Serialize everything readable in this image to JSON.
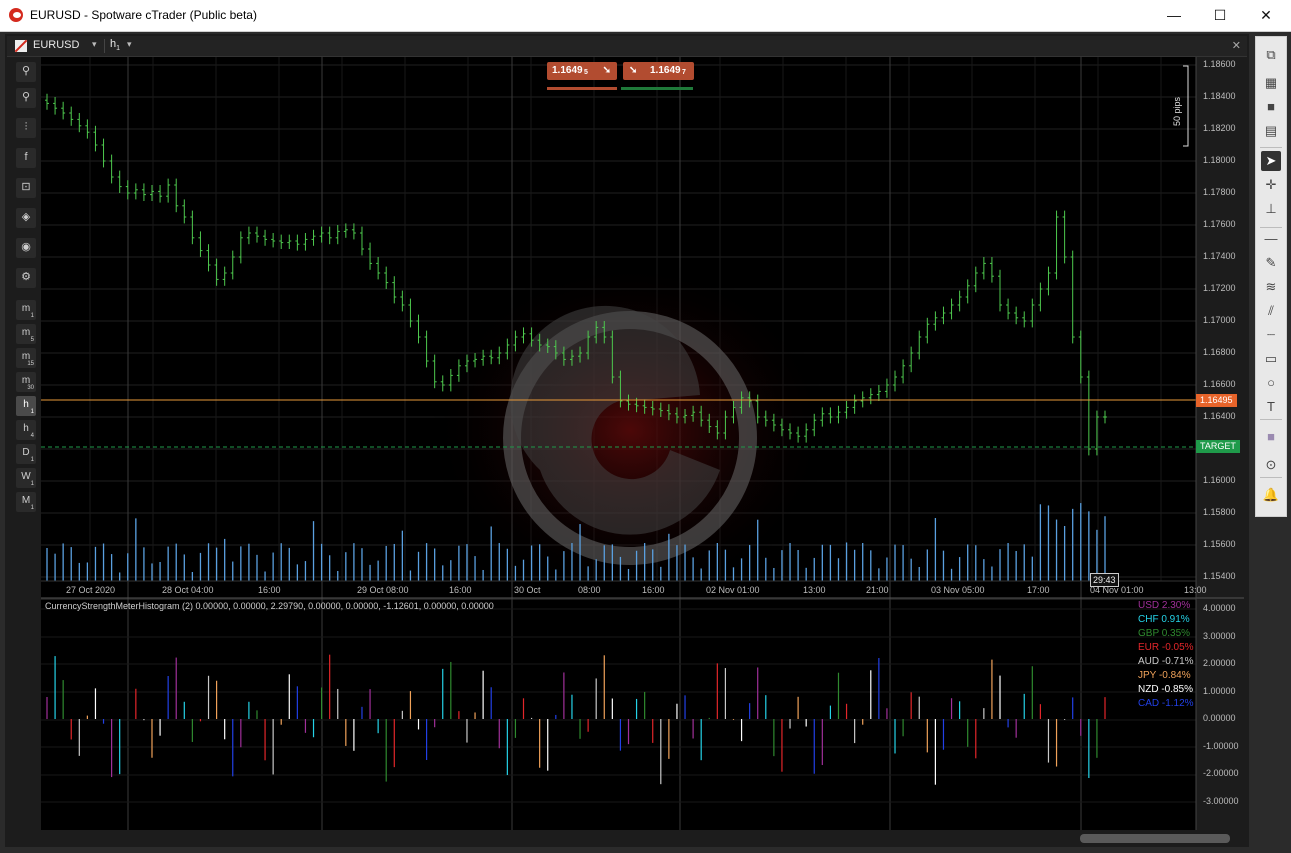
{
  "window": {
    "title": "EURUSD - Spotware cTrader (Public beta)",
    "minimize": "—",
    "maximize": "☐",
    "close": "✕"
  },
  "symbol_bar": {
    "symbol": "EURUSD",
    "timeframe": "h",
    "timeframe_sub": "1",
    "dropdown": "▾"
  },
  "left_toolbar": {
    "tools": [
      {
        "name": "zoom-in-icon",
        "glyph": "⚲"
      },
      {
        "name": "zoom-out-icon",
        "glyph": "⚲"
      },
      {
        "name": "indicators-icon",
        "glyph": "⫶"
      },
      {
        "name": "facebook-icon",
        "glyph": "f"
      },
      {
        "name": "robot-icon",
        "glyph": "⊡"
      },
      {
        "name": "layers-icon",
        "glyph": "◈"
      },
      {
        "name": "eye-icon",
        "glyph": "◉"
      },
      {
        "name": "settings-icon",
        "glyph": "⚙"
      }
    ],
    "timeframes": [
      {
        "label": "m",
        "sub": "1"
      },
      {
        "label": "m",
        "sub": "5"
      },
      {
        "label": "m",
        "sub": "15"
      },
      {
        "label": "m",
        "sub": "30"
      },
      {
        "label": "h",
        "sub": "1"
      },
      {
        "label": "h",
        "sub": "4"
      },
      {
        "label": "D",
        "sub": "1"
      },
      {
        "label": "W",
        "sub": "1"
      },
      {
        "label": "M",
        "sub": "1"
      }
    ],
    "active_timeframe": 4
  },
  "right_toolbar": {
    "tools": [
      "chart-type-icon",
      "layout-grid-icon",
      "layout-single-icon",
      "layout-split-icon",
      "cursor-icon",
      "crosshair-icon",
      "magnet-icon",
      "horizontal-line-icon",
      "pencil-icon",
      "fibonacci-icon",
      "channel-icon",
      "ruler-icon",
      "rectangle-icon",
      "ellipse-icon",
      "text-icon",
      "color-icon",
      "camera-icon",
      "alert-icon"
    ],
    "glyphs": [
      "⧉",
      "▦",
      "■",
      "▤",
      "➤",
      "✛",
      "⊥",
      "—",
      "✎",
      "≋",
      "⫽",
      "┈",
      "▭",
      "○",
      "T",
      "■",
      "⊙",
      "🔔"
    ]
  },
  "order_buttons": {
    "sell_price": "1.1649",
    "sell_price_sub": "5",
    "buy_price": "1.1649",
    "buy_price_sub": "7",
    "sell_arrow": "➘",
    "buy_arrow": "➘",
    "sell_color": "#b24c30",
    "buy_color": "#b24c30"
  },
  "price_axis": {
    "labels": [
      "1.18600",
      "1.18400",
      "1.18200",
      "1.18000",
      "1.17800",
      "1.17600",
      "1.17400",
      "1.17200",
      "1.17000",
      "1.16800",
      "1.16600",
      "1.16400",
      "1.16200",
      "1.16000",
      "1.15800",
      "1.15600",
      "1.15400"
    ],
    "current_price": "1.16495",
    "target_label": "TARGET",
    "pips_label": "50 pips",
    "current_color": "#e8642a",
    "target_color": "#1f9a4a"
  },
  "time_axis": {
    "labels": [
      "27 Oct 2020",
      "28 Oct 04:00",
      "16:00",
      "29 Oct",
      "08:00",
      "16:00",
      "30 Oct",
      "08:00",
      "16:00",
      "02 Nov 01:00",
      "13:00",
      "21:00",
      "03 Nov 05:00",
      "17:00",
      "04 Nov 01:00",
      "13:00"
    ],
    "countdown": "29:43"
  },
  "indicator": {
    "title": "CurrencyStrengthMeterHistogram (2) 0.00000, 0.00000, 2.29790, 0.00000, 0.00000, -1.12601, 0.00000, 0.00000",
    "axis": [
      "4.00000",
      "3.00000",
      "2.00000",
      "1.00000",
      "0.00000",
      "-1.00000",
      "-2.00000",
      "-3.00000"
    ],
    "legend": [
      {
        "label": "USD 2.30%",
        "color": "#a0309a"
      },
      {
        "label": "CHF 0.91%",
        "color": "#25d3e8"
      },
      {
        "label": "GBP 0.35%",
        "color": "#2f8a2f"
      },
      {
        "label": "EUR -0.05%",
        "color": "#e2262a"
      },
      {
        "label": "AUD -0.71%",
        "color": "#c9c9c9"
      },
      {
        "label": "JPY -0.84%",
        "color": "#f0a25a"
      },
      {
        "label": "NZD -0.85%",
        "color": "#ffffff"
      },
      {
        "label": "CAD -1.12%",
        "color": "#2240e6"
      }
    ]
  }
}
